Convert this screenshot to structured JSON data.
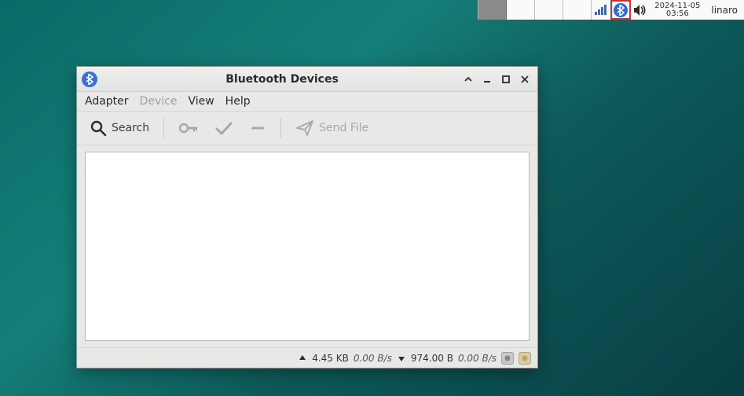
{
  "panel": {
    "clock_date": "2024-11-05",
    "clock_time": "03:56",
    "user": "linaro"
  },
  "window": {
    "title": "Bluetooth Devices",
    "menu": {
      "adapter": "Adapter",
      "device": "Device",
      "view": "View",
      "help": "Help"
    },
    "toolbar": {
      "search": "Search",
      "send_file": "Send File"
    },
    "status": {
      "up_total": "4.45 KB",
      "up_rate": "0.00 B/s",
      "down_total": "974.00 B",
      "down_rate": "0.00 B/s"
    }
  }
}
